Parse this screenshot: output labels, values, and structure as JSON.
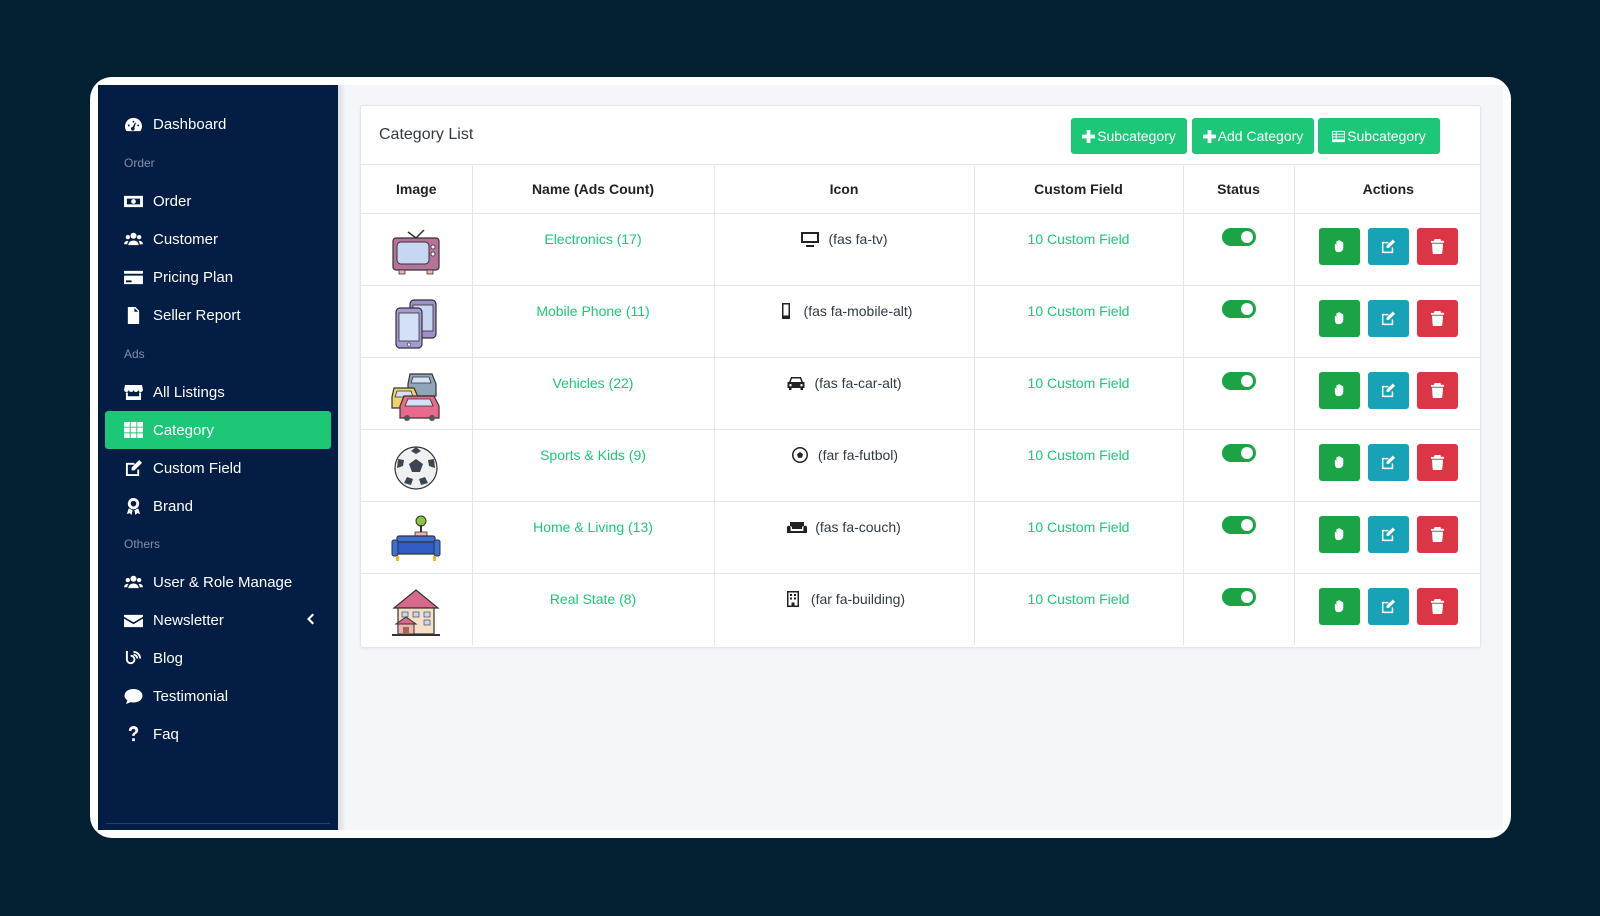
{
  "sidebar": {
    "items": [
      {
        "id": "dashboard",
        "label": "Dashboard",
        "icon": "gauge-icon"
      },
      {
        "id": "order",
        "label": "Order",
        "icon": "money-icon"
      },
      {
        "id": "customer",
        "label": "Customer",
        "icon": "users-icon"
      },
      {
        "id": "pricing-plan",
        "label": "Pricing Plan",
        "icon": "credit-card-icon"
      },
      {
        "id": "seller-report",
        "label": "Seller Report",
        "icon": "file-icon"
      },
      {
        "id": "all-listings",
        "label": "All Listings",
        "icon": "store-icon"
      },
      {
        "id": "category",
        "label": "Category",
        "icon": "grid-icon",
        "active": true
      },
      {
        "id": "custom-field",
        "label": "Custom Field",
        "icon": "edit-icon"
      },
      {
        "id": "brand",
        "label": "Brand",
        "icon": "award-icon"
      },
      {
        "id": "user-role",
        "label": "User & Role Manage",
        "icon": "users-icon"
      },
      {
        "id": "newsletter",
        "label": "Newsletter",
        "icon": "envelope-icon"
      },
      {
        "id": "blog",
        "label": "Blog",
        "icon": "blog-icon"
      },
      {
        "id": "testimonial",
        "label": "Testimonial",
        "icon": "comment-icon"
      },
      {
        "id": "faq",
        "label": "Faq",
        "icon": "question-icon"
      }
    ],
    "sections": {
      "order": "Order",
      "ads": "Ads",
      "others": "Others"
    }
  },
  "card": {
    "title": "Category List",
    "buttons": {
      "subcategory_add": "Subcategory",
      "add_category": "Add Category",
      "subcategory_list": "Subcategory"
    }
  },
  "table": {
    "headers": [
      "Image",
      "Name (Ads Count)",
      "Icon",
      "Custom Field",
      "Status",
      "Actions"
    ],
    "rows": [
      {
        "name": "Electronics (17)",
        "icon_class": "(fas fa-tv)",
        "custom_field": "10 Custom Field",
        "image": "tv-image",
        "glyph": "tv-icon"
      },
      {
        "name": "Mobile Phone (11)",
        "icon_class": "(fas fa-mobile-alt)",
        "custom_field": "10 Custom Field",
        "image": "phones-image",
        "glyph": "mobile-icon"
      },
      {
        "name": "Vehicles (22)",
        "icon_class": "(fas fa-car-alt)",
        "custom_field": "10 Custom Field",
        "image": "vehicles-image",
        "glyph": "car-icon"
      },
      {
        "name": "Sports & Kids (9)",
        "icon_class": "(far fa-futbol)",
        "custom_field": "10 Custom Field",
        "image": "football-image",
        "glyph": "futbol-icon"
      },
      {
        "name": "Home & Living (13)",
        "icon_class": "(fas fa-couch)",
        "custom_field": "10 Custom Field",
        "image": "couch-image",
        "glyph": "couch-icon"
      },
      {
        "name": "Real State (8)",
        "icon_class": "(far fa-building)",
        "custom_field": "10 Custom Field",
        "image": "house-image",
        "glyph": "building-icon"
      }
    ]
  },
  "colors": {
    "background": "#032033",
    "sidebar": "#031d44",
    "accent": "#1cc878",
    "toggle": "#1ba446",
    "edit": "#17a2b8",
    "delete": "#dc3545"
  }
}
